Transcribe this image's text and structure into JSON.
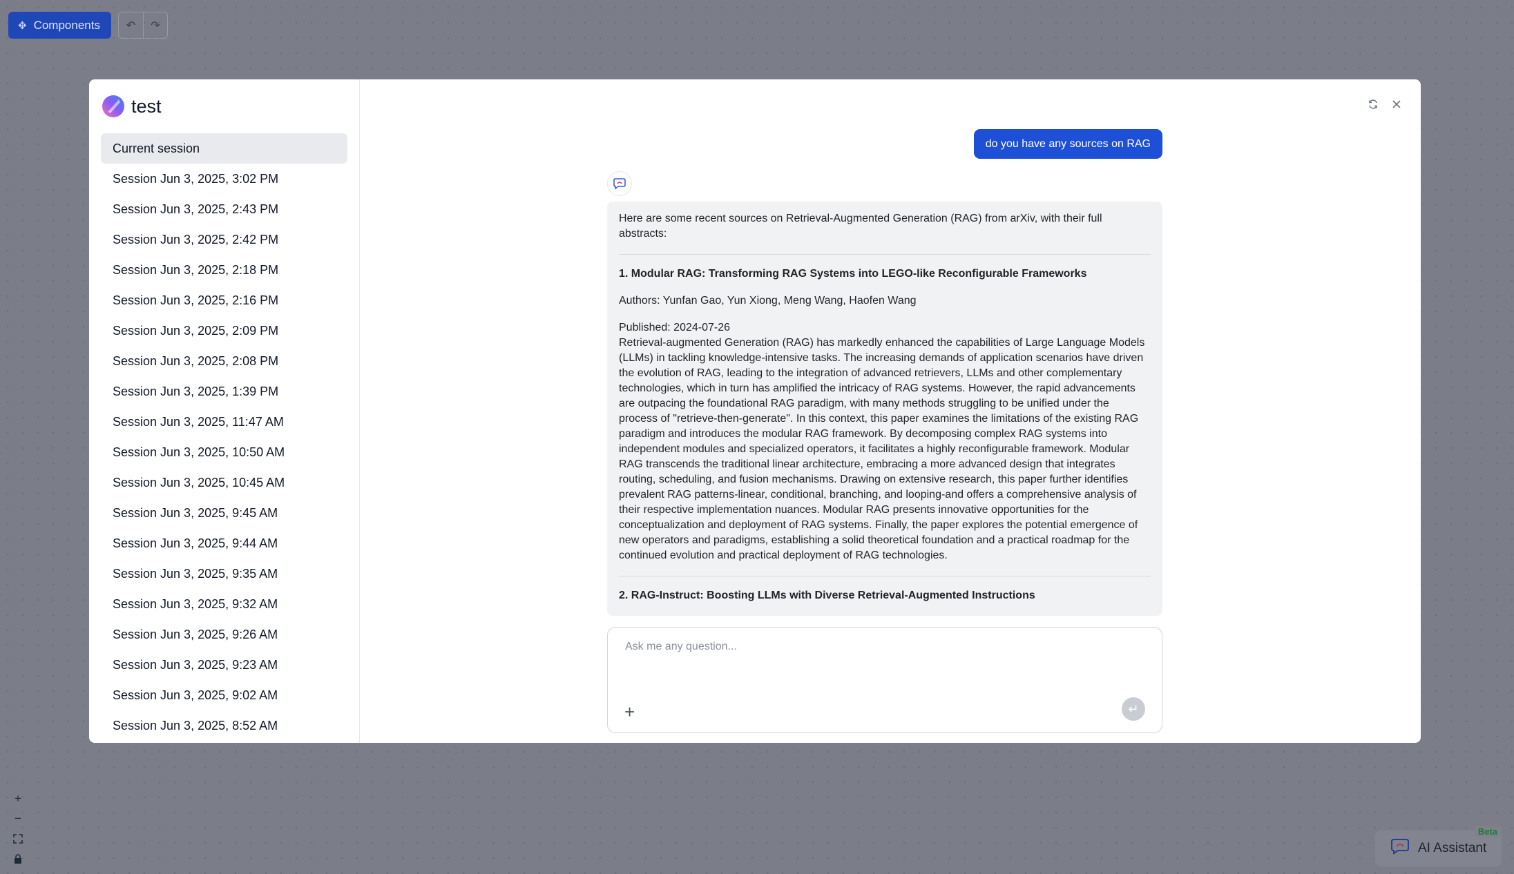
{
  "toolbar": {
    "components_label": "Components"
  },
  "flow": {
    "title": "test"
  },
  "sidebar": {
    "sessions": [
      "Current session",
      "Session Jun 3, 2025, 3:02 PM",
      "Session Jun 3, 2025, 2:43 PM",
      "Session Jun 3, 2025, 2:42 PM",
      "Session Jun 3, 2025, 2:18 PM",
      "Session Jun 3, 2025, 2:16 PM",
      "Session Jun 3, 2025, 2:09 PM",
      "Session Jun 3, 2025, 2:08 PM",
      "Session Jun 3, 2025, 1:39 PM",
      "Session Jun 3, 2025, 11:47 AM",
      "Session Jun 3, 2025, 10:50 AM",
      "Session Jun 3, 2025, 10:45 AM",
      "Session Jun 3, 2025, 9:45 AM",
      "Session Jun 3, 2025, 9:44 AM",
      "Session Jun 3, 2025, 9:35 AM",
      "Session Jun 3, 2025, 9:32 AM",
      "Session Jun 3, 2025, 9:26 AM",
      "Session Jun 3, 2025, 9:23 AM",
      "Session Jun 3, 2025, 9:02 AM",
      "Session Jun 3, 2025, 8:52 AM"
    ]
  },
  "chat": {
    "user_message": "do you have any sources on RAG",
    "bot": {
      "intro": "Here are some recent sources on Retrieval-Augmented Generation (RAG) from arXiv, with their full abstracts:",
      "paper1_title": "1. Modular RAG: Transforming RAG Systems into LEGO-like Reconfigurable Frameworks",
      "paper1_authors": "Authors: Yunfan Gao, Yun Xiong, Meng Wang, Haofen Wang",
      "paper1_published": "Published: 2024-07-26",
      "paper1_abstract": "Retrieval-augmented Generation (RAG) has markedly enhanced the capabilities of Large Language Models (LLMs) in tackling knowledge-intensive tasks. The increasing demands of application scenarios have driven the evolution of RAG, leading to the integration of advanced retrievers, LLMs and other complementary technologies, which in turn has amplified the intricacy of RAG systems. However, the rapid advancements are outpacing the foundational RAG paradigm, with many methods struggling to be unified under the process of \"retrieve-then-generate\". In this context, this paper examines the limitations of the existing RAG paradigm and introduces the modular RAG framework. By decomposing complex RAG systems into independent modules and specialized operators, it facilitates a highly reconfigurable framework. Modular RAG transcends the traditional linear architecture, embracing a more advanced design that integrates routing, scheduling, and fusion mechanisms. Drawing on extensive research, this paper further identifies prevalent RAG patterns-linear, conditional, branching, and looping-and offers a comprehensive analysis of their respective implementation nuances. Modular RAG presents innovative opportunities for the conceptualization and deployment of RAG systems. Finally, the paper explores the potential emergence of new operators and paradigms, establishing a solid theoretical foundation and a practical roadmap for the continued evolution and practical deployment of RAG technologies.",
      "paper2_title": "2. RAG-Instruct: Boosting LLMs with Diverse Retrieval-Augmented Instructions"
    },
    "input_placeholder": "Ask me any question..."
  },
  "assistant": {
    "label": "AI Assistant",
    "badge": "Beta"
  },
  "icons": {
    "components": "component-icon",
    "undo": "undo-icon",
    "redo": "redo-icon",
    "refresh": "refresh-icon",
    "close": "close-icon",
    "plus": "plus-icon",
    "send": "send-icon",
    "zoom_in": "zoom-in-icon",
    "zoom_out": "zoom-out-icon",
    "fit_view": "fit-view-icon",
    "lock": "lock-icon"
  },
  "colors": {
    "accent": "#1e50d7",
    "canvas": "#7b7e88",
    "badge_text": "#1f7a3a"
  }
}
